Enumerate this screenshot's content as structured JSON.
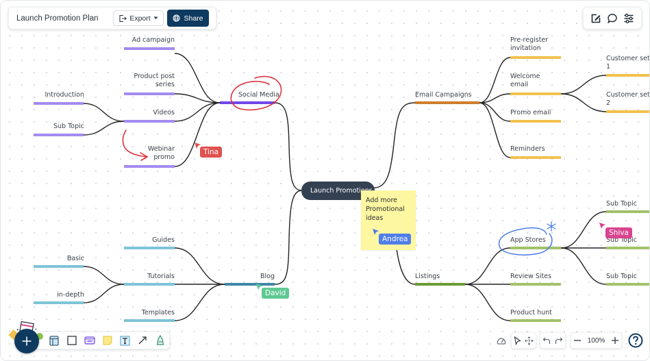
{
  "header": {
    "title": "Launch Promotion Plan",
    "export_label": "Export",
    "share_label": "Share"
  },
  "right_tools": [
    {
      "icon": "edit-icon",
      "label": "Edit"
    },
    {
      "icon": "comment-icon",
      "label": "Comments"
    },
    {
      "icon": "settings-sliders-icon",
      "label": "Settings"
    }
  ],
  "mindmap": {
    "root": "Launch Promotions",
    "colors": {
      "social_media": "#7048e8",
      "social_media_children": "#a48bf0",
      "blog": "#3f87a6",
      "blog_children": "#7ec4d8",
      "email": "#cf7f2e",
      "email_children": "#f2c14e",
      "listings": "#6d9b34",
      "listings_children": "#a2c26b"
    },
    "branches": {
      "social_media": {
        "label": "Social Media",
        "children": [
          {
            "label": "Ad campaign"
          },
          {
            "label": "Product post series"
          },
          {
            "label": "Videos",
            "children": [
              {
                "label": "Introduction"
              },
              {
                "label": "Sub Topic"
              }
            ]
          },
          {
            "label": "Webinar promo"
          }
        ]
      },
      "blog": {
        "label": "Blog",
        "children": [
          {
            "label": "Guides"
          },
          {
            "label": "Tutorials",
            "children": [
              {
                "label": "Basic"
              },
              {
                "label": "in-depth"
              }
            ]
          },
          {
            "label": "Templates"
          }
        ]
      },
      "email": {
        "label": "Email Campaigns",
        "children": [
          {
            "label": "Pre-register invitation"
          },
          {
            "label": "Welcome email",
            "children": [
              {
                "label": "Customer set 1"
              },
              {
                "label": "Customer set 2"
              }
            ]
          },
          {
            "label": "Promo email"
          },
          {
            "label": "Reminders"
          }
        ]
      },
      "listings": {
        "label": "Listings",
        "children": [
          {
            "label": "App Stores",
            "children": [
              {
                "label": "Sub Topic"
              },
              {
                "label": "Sub Topic"
              },
              {
                "label": "Sub Topic"
              }
            ]
          },
          {
            "label": "Review Sites"
          },
          {
            "label": "Product hunt"
          }
        ]
      }
    },
    "labels": {
      "ad_campaign": "Ad campaign",
      "product_post_1": "Product post",
      "product_post_2": "series",
      "videos": "Videos",
      "introduction": "Introduction",
      "sub_topic_left": "Sub Topic",
      "webinar_1": "Webinar",
      "webinar_2": "promo",
      "social_media": "Social Media",
      "guides": "Guides",
      "tutorials": "Tutorials",
      "templates": "Templates",
      "basic": "Basic",
      "in_depth": "in-depth",
      "blog": "Blog",
      "email_campaigns": "Email Campaigns",
      "preregister_1": "Pre-register",
      "preregister_2": "invitation",
      "welcome_1": "Welcome",
      "welcome_2": "email",
      "promo_email": "Promo email",
      "reminders": "Reminders",
      "customer1_1": "Customer set",
      "customer1_2": "1",
      "customer2_1": "Customer set",
      "customer2_2": "2",
      "listings": "Listings",
      "app_stores": "App Stores",
      "review_sites": "Review Sites",
      "product_hunt": "Product hunt",
      "sub_topic_r1": "Sub Topic",
      "sub_topic_r2": "Sub Topic",
      "sub_topic_r3": "Sub Topic"
    }
  },
  "sticky_note": {
    "text": "Add more Promotional ideas",
    "color": "#fdf7a1"
  },
  "collaborators": [
    {
      "name": "Tina",
      "color": "#e0524f"
    },
    {
      "name": "Andrea",
      "color": "#4f7ee8"
    },
    {
      "name": "David",
      "color": "#5fc992"
    },
    {
      "name": "Shiva",
      "color": "#d9448f"
    }
  ],
  "bottom_toolbar": {
    "add_icon": "plus-icon",
    "tools": [
      "template-icon",
      "rectangle-icon",
      "card-icon",
      "sticky-note-icon",
      "text-icon",
      "arrow-icon",
      "pen-icon"
    ]
  },
  "bottom_right": {
    "zoom_level": "100%",
    "tools": [
      "performance-icon",
      "select-icon",
      "pan-icon",
      "undo-icon",
      "redo-icon",
      "zoom-out-icon",
      "zoom-in-icon",
      "help-icon"
    ]
  },
  "accent_color": "#0f3a5f"
}
